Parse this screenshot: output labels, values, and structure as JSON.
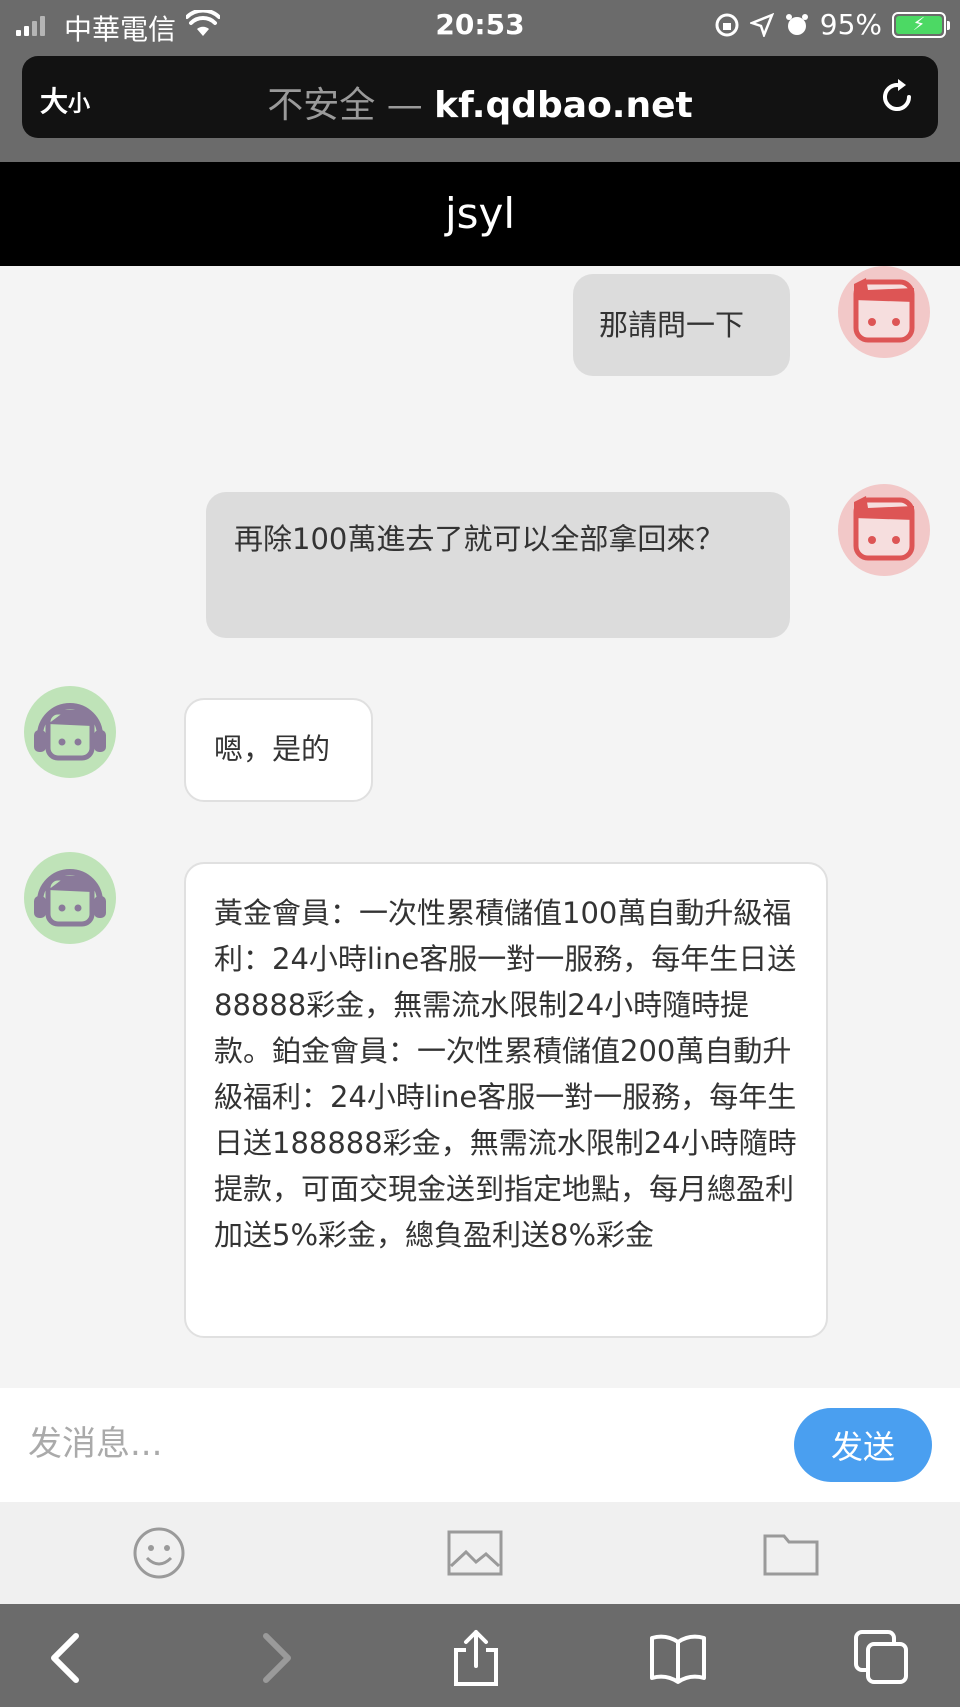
{
  "status_bar": {
    "carrier": "中華電信",
    "time": "20:53",
    "battery": "95%"
  },
  "url_bar": {
    "text_size_big": "大",
    "text_size_small": "小",
    "insecure_label": "不安全 —",
    "domain": "kf.qdbao.net"
  },
  "chat": {
    "title": "jsyl",
    "messages": [
      {
        "sender": "user",
        "text": "那請問一下"
      },
      {
        "sender": "user",
        "text": "再除100萬進去了就可以全部拿回來？"
      },
      {
        "sender": "agent",
        "text": "嗯，是的"
      },
      {
        "sender": "agent",
        "text": "黃金會員：一次性累積儲值100萬自動升級福利：24小時line客服一對一服務，每年生日送88888彩金，無需流水限制24小時隨時提款。鉑金會員：一次性累積儲值200萬自動升級福利：24小時line客服一對一服務，每年生日送188888彩金，無需流水限制24小時隨時提款，可面交現金送到指定地點，每月總盈利加送5%彩金，總負盈利送8%彩金"
      }
    ]
  },
  "input": {
    "placeholder": "发消息...",
    "value": "",
    "send_label": "发送"
  },
  "tools": {
    "emoji": "emoji-icon",
    "image": "image-icon",
    "file": "folder-icon"
  },
  "colors": {
    "send_button": "#4a9ff0",
    "user_bubble": "#dcdcdc",
    "agent_bubble": "#ffffff",
    "user_avatar": "#f2c8c8",
    "agent_avatar": "#bfe3b8",
    "header": "#000000"
  }
}
